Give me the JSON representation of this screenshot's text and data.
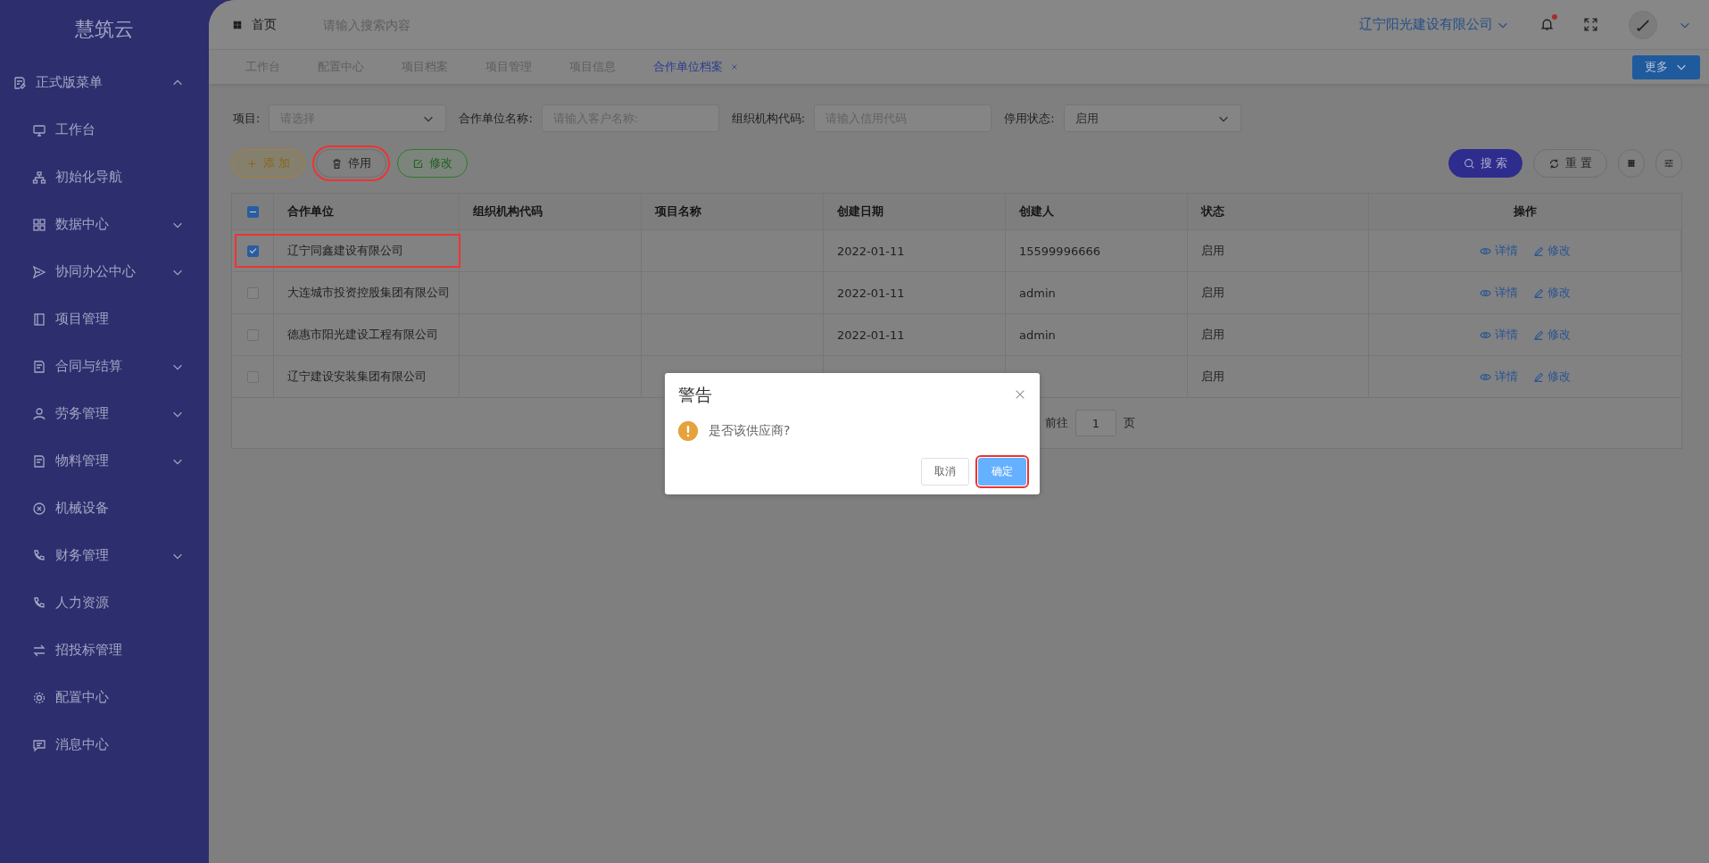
{
  "sidebar": {
    "logo": "慧筑云",
    "section": {
      "label": "正式版菜单",
      "expanded": true
    },
    "items": [
      {
        "label": "工作台",
        "expandable": false
      },
      {
        "label": "初始化导航",
        "expandable": false
      },
      {
        "label": "数据中心",
        "expandable": true
      },
      {
        "label": "协同办公中心",
        "expandable": true
      },
      {
        "label": "项目管理",
        "expandable": false
      },
      {
        "label": "合同与结算",
        "expandable": true
      },
      {
        "label": "劳务管理",
        "expandable": true
      },
      {
        "label": "物料管理",
        "expandable": true
      },
      {
        "label": "机械设备",
        "expandable": false
      },
      {
        "label": "财务管理",
        "expandable": true
      },
      {
        "label": "人力资源",
        "expandable": false
      },
      {
        "label": "招投标管理",
        "expandable": false
      },
      {
        "label": "配置中心",
        "expandable": false
      },
      {
        "label": "消息中心",
        "expandable": false
      }
    ]
  },
  "header": {
    "home": "首页",
    "search_placeholder": "请输入搜索内容",
    "company": "辽宁阳光建设有限公司",
    "notification_dot": true
  },
  "tabs": [
    {
      "label": "工作台",
      "selected": false
    },
    {
      "label": "配置中心",
      "selected": false
    },
    {
      "label": "项目档案",
      "selected": false
    },
    {
      "label": "项目管理",
      "selected": false
    },
    {
      "label": "项目信息",
      "selected": false
    },
    {
      "label": "合作单位档案",
      "selected": true
    }
  ],
  "more_button": "更多",
  "filters": [
    {
      "label": "项目:",
      "kind": "select",
      "placeholder": "请选择"
    },
    {
      "label": "合作单位名称:",
      "kind": "input",
      "placeholder": "请输入客户名称:"
    },
    {
      "label": "组织机构代码:",
      "kind": "input",
      "placeholder": "请输入信用代码"
    },
    {
      "label": "停用状态:",
      "kind": "select",
      "value": "启用"
    }
  ],
  "actions": [
    {
      "label": "添 加",
      "kind": "add",
      "highlighted": false
    },
    {
      "label": "停用",
      "kind": "disable",
      "highlighted": true
    },
    {
      "label": "修改",
      "kind": "edit",
      "highlighted": false
    }
  ],
  "search_button": "搜 索",
  "reset_button": "重 置",
  "table": {
    "select_all_partial": true,
    "columns": [
      "合作单位",
      "组织机构代码",
      "项目名称",
      "创建日期",
      "创建人",
      "状态",
      "操作"
    ],
    "rows": [
      {
        "selected": true,
        "highlighted": true,
        "company": "辽宁同鑫建设有限公司",
        "date": "2022-01-11",
        "creator": "15599996666",
        "status": "启用",
        "actions": [
          "详情",
          "修改"
        ]
      },
      {
        "selected": false,
        "highlighted": false,
        "company": "大连城市投资控股集团有限公司",
        "date": "2022-01-11",
        "creator": "admin",
        "status": "启用",
        "actions": [
          "详情",
          "修改"
        ]
      },
      {
        "selected": false,
        "highlighted": false,
        "company": "德惠市阳光建设工程有限公司",
        "date": "2022-01-11",
        "creator": "admin",
        "status": "启用",
        "actions": [
          "详情",
          "修改"
        ]
      },
      {
        "selected": false,
        "highlighted": false,
        "company": "辽宁建设安装集团有限公司",
        "status": "启用",
        "actions": [
          "详情",
          "修改"
        ]
      }
    ],
    "pagination": {
      "goto": "前往",
      "page": "1",
      "suffix": "页"
    }
  },
  "dialog": {
    "title": "警告",
    "message": "是否该供应商?",
    "cancel": "取消",
    "confirm": "确定",
    "confirm_highlighted": true
  }
}
